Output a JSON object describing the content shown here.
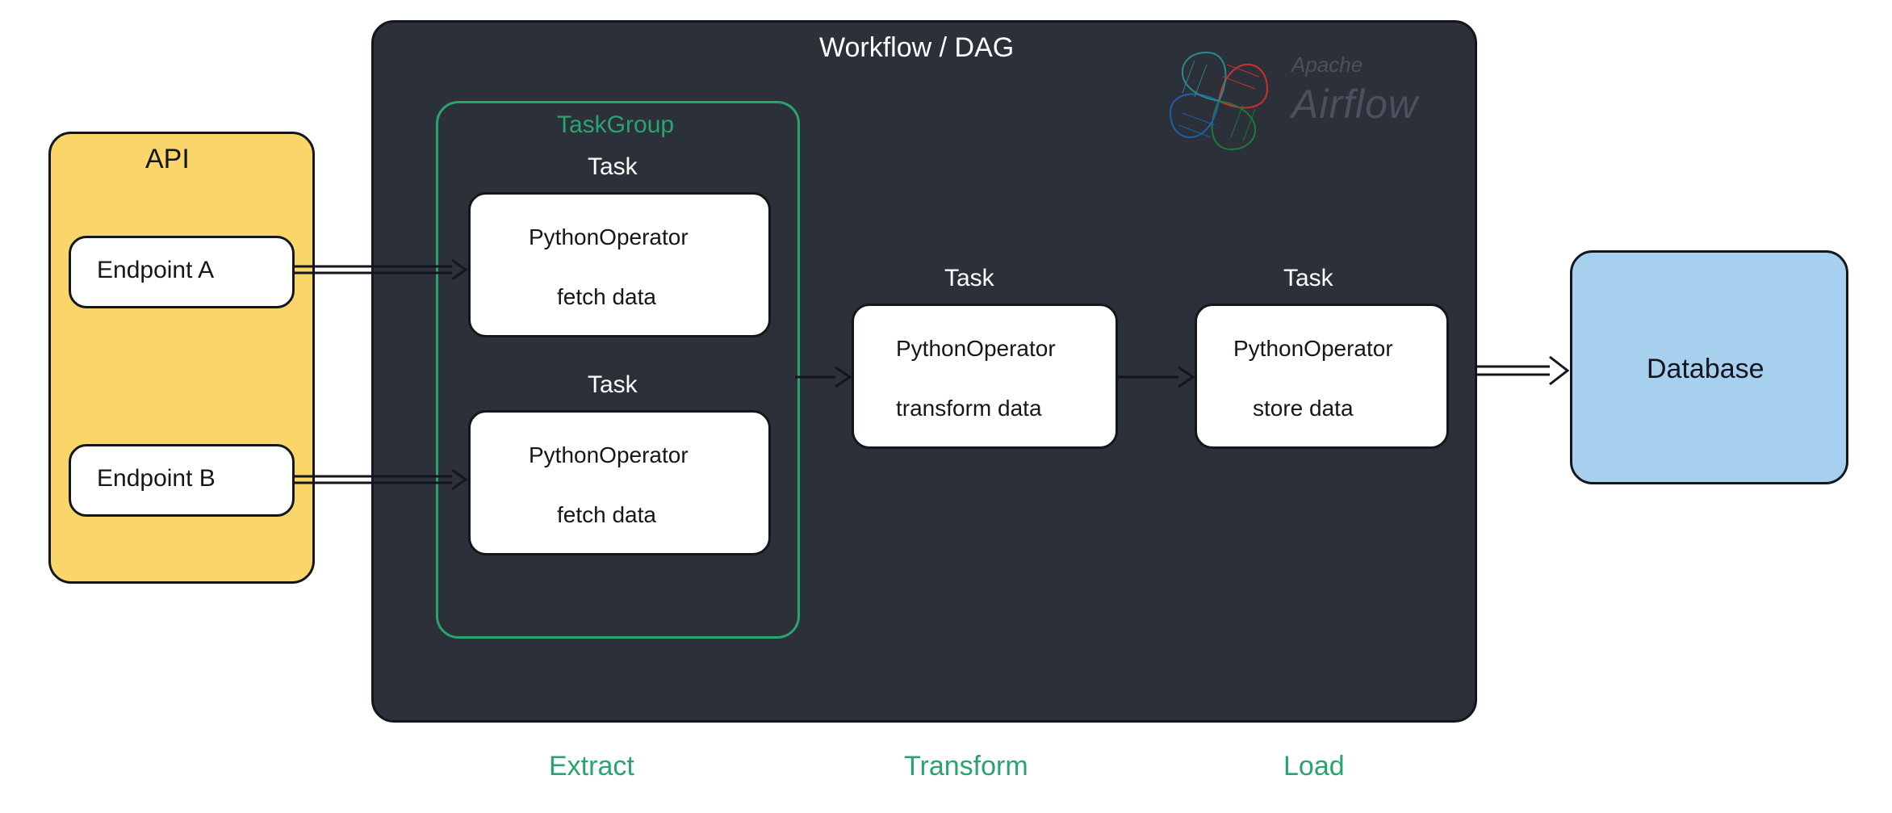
{
  "api": {
    "title": "API",
    "endpoint_a": "Endpoint A",
    "endpoint_b": "Endpoint B"
  },
  "dag": {
    "title": "Workflow / DAG",
    "logo_brand_top": "Apache",
    "logo_brand_bottom": "Airflow",
    "taskgroup_title": "TaskGroup",
    "task_label": "Task",
    "fetch_a": {
      "operator": "PythonOperator",
      "action": "fetch data"
    },
    "fetch_b": {
      "operator": "PythonOperator",
      "action": "fetch data"
    },
    "transform": {
      "operator": "PythonOperator",
      "action": "transform data"
    },
    "store": {
      "operator": "PythonOperator",
      "action": "store data"
    }
  },
  "db": {
    "title": "Database"
  },
  "stages": {
    "extract": "Extract",
    "transform": "Transform",
    "load": "Load"
  }
}
